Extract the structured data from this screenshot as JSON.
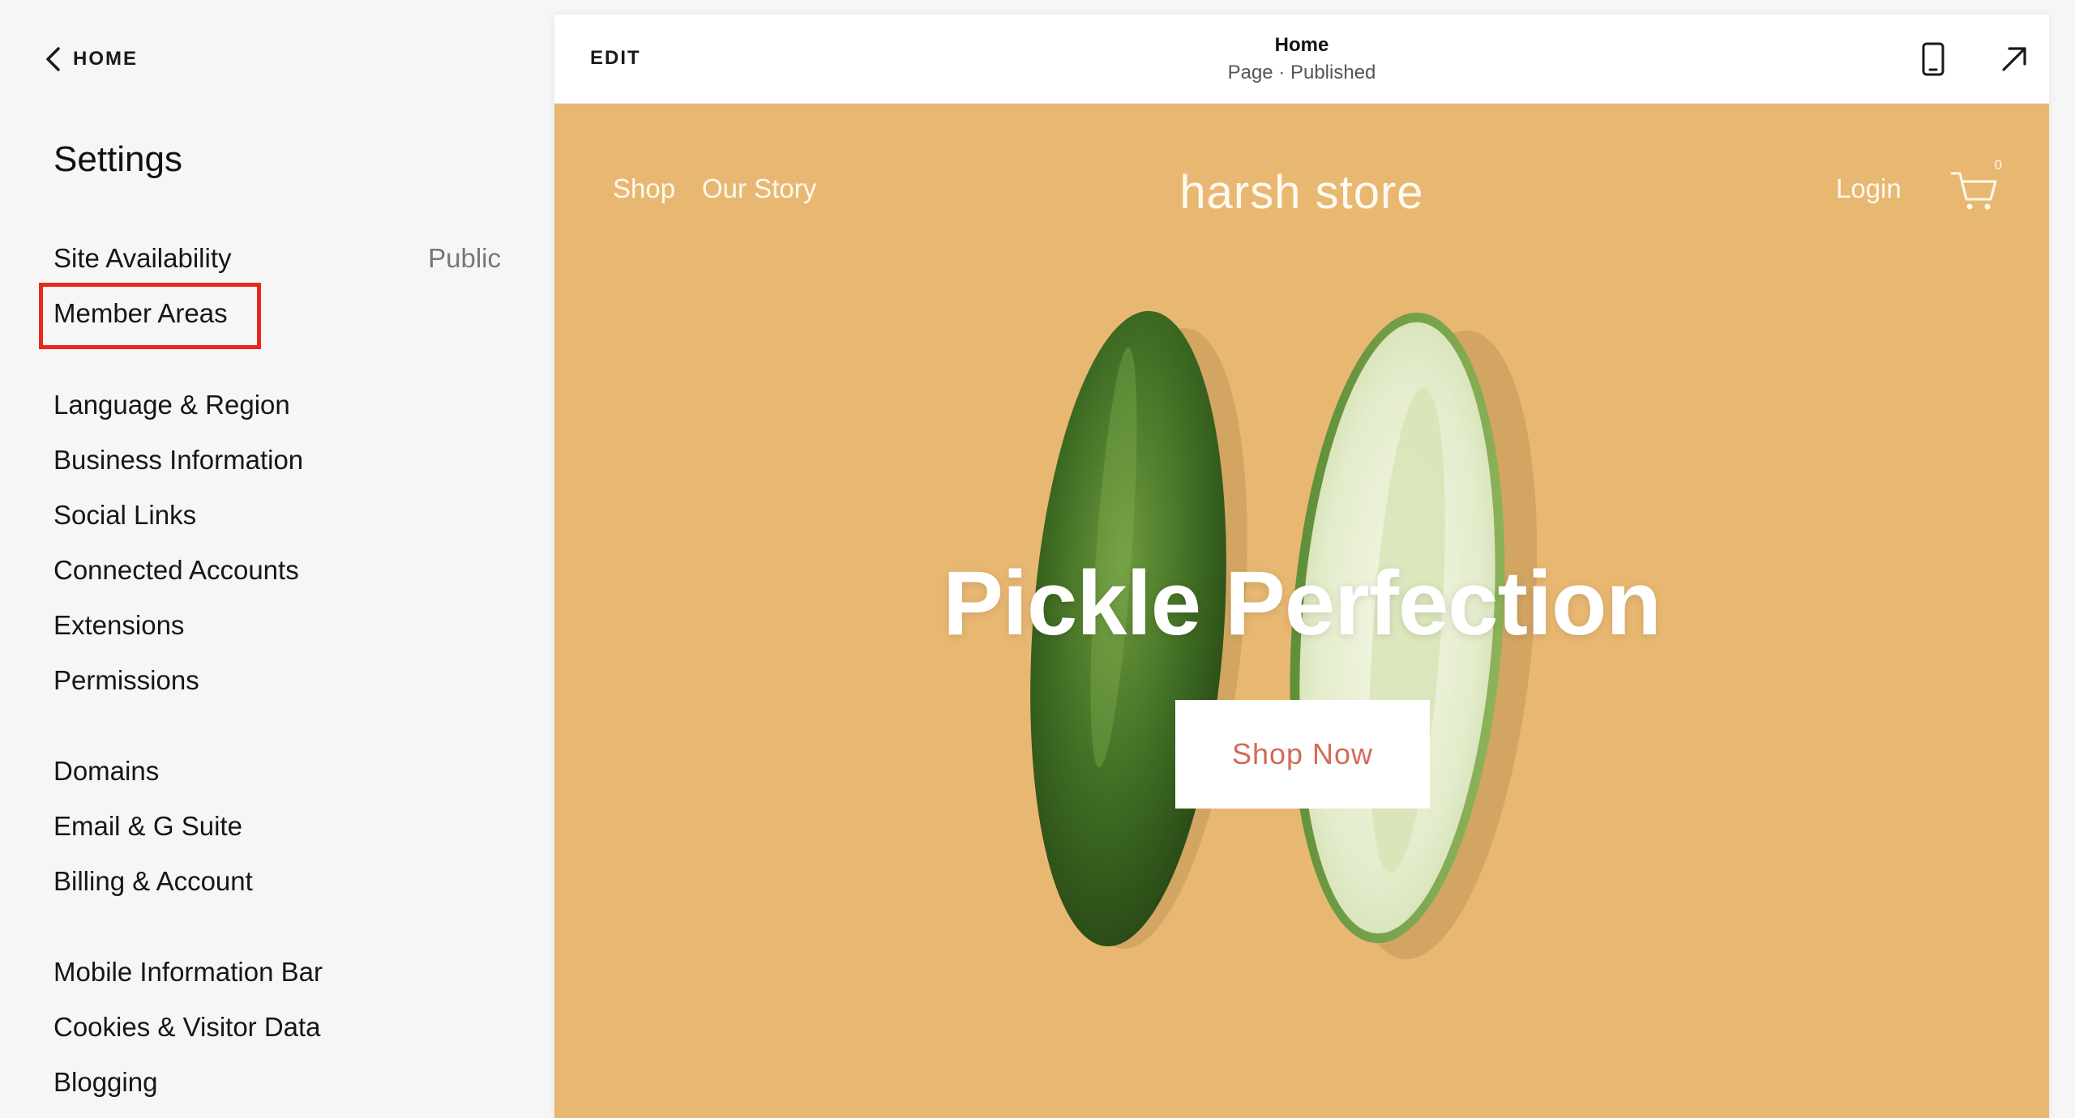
{
  "sidebar": {
    "back_label": "HOME",
    "title": "Settings",
    "items": [
      {
        "label": "Site Availability",
        "value": "Public"
      },
      {
        "label": "Member Areas"
      },
      {
        "label": "Language & Region"
      },
      {
        "label": "Business Information"
      },
      {
        "label": "Social Links"
      },
      {
        "label": "Connected Accounts"
      },
      {
        "label": "Extensions"
      },
      {
        "label": "Permissions"
      },
      {
        "label": "Domains"
      },
      {
        "label": "Email & G Suite"
      },
      {
        "label": "Billing & Account"
      },
      {
        "label": "Mobile Information Bar"
      },
      {
        "label": "Cookies & Visitor Data"
      },
      {
        "label": "Blogging"
      }
    ],
    "highlight_color": "#e8281e"
  },
  "preview": {
    "edit_label": "EDIT",
    "page_name": "Home",
    "page_status": "Page · Published",
    "icons": [
      "mobile-preview-icon",
      "open-external-icon"
    ]
  },
  "site": {
    "nav": [
      "Shop",
      "Our Story"
    ],
    "logo": "harsh store",
    "login": "Login",
    "cart_count": "0",
    "hero_title": "Pickle Perfection",
    "cta": "Shop Now",
    "background_color": "#e8b872",
    "cta_text_color": "#d46a58"
  }
}
